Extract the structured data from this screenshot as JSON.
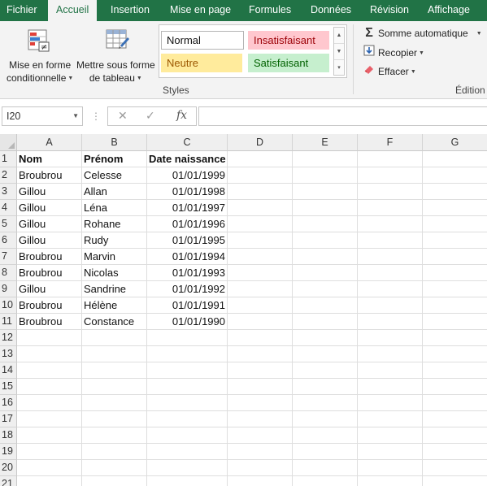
{
  "tabs": [
    "Fichier",
    "Accueil",
    "Insertion",
    "Mise en page",
    "Formules",
    "Données",
    "Révision",
    "Affichage"
  ],
  "active_tab": "Accueil",
  "ribbon": {
    "conditional_format": {
      "line1": "Mise en forme",
      "line2": "conditionnelle"
    },
    "format_table": {
      "line1": "Mettre sous forme",
      "line2": "de tableau"
    },
    "styles": {
      "normal": "Normal",
      "insatisfaisant": "Insatisfaisant",
      "neutre": "Neutre",
      "satisfaisant": "Satisfaisant",
      "group_label": "Styles"
    },
    "editing": {
      "autosum": "Somme automatique",
      "fill": "Recopier",
      "clear": "Effacer",
      "group_label": "Édition"
    }
  },
  "formula_bar": {
    "name_box": "I20",
    "formula": ""
  },
  "columns": [
    "A",
    "B",
    "C",
    "D",
    "E",
    "F",
    "G"
  ],
  "rows": [
    [
      "Nom",
      "Prénom",
      "Date naissance"
    ],
    [
      "Broubrou",
      "Celesse",
      "01/01/1999"
    ],
    [
      "Gillou",
      "Allan",
      "01/01/1998"
    ],
    [
      "Gillou",
      "Léna",
      "01/01/1997"
    ],
    [
      "Gillou",
      "Rohane",
      "01/01/1996"
    ],
    [
      "Gillou",
      "Rudy",
      "01/01/1995"
    ],
    [
      "Broubrou",
      "Marvin",
      "01/01/1994"
    ],
    [
      "Broubrou",
      "Nicolas",
      "01/01/1993"
    ],
    [
      "Gillou",
      "Sandrine",
      "01/01/1992"
    ],
    [
      "Broubrou",
      "Hélène",
      "01/01/1991"
    ],
    [
      "Broubrou",
      "Constance",
      "01/01/1990"
    ]
  ],
  "row_numbers": [
    "1",
    "2",
    "3",
    "4",
    "5",
    "6",
    "7",
    "8",
    "9",
    "10",
    "11",
    "12",
    "13",
    "14",
    "15",
    "16",
    "17",
    "18",
    "19",
    "20",
    "21"
  ],
  "colors": {
    "excel_green": "#217346",
    "bad_fill": "#ffc7ce",
    "bad_text": "#9c0006",
    "neutral_fill": "#ffeb9c",
    "neutral_text": "#9c5700",
    "good_fill": "#c6efce",
    "good_text": "#006100"
  }
}
